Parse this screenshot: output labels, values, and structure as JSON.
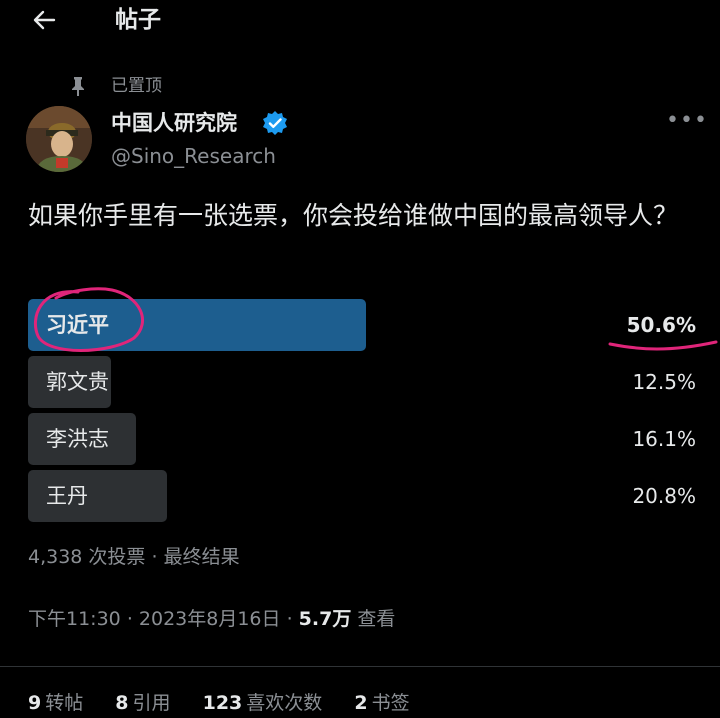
{
  "header": {
    "title": "帖子"
  },
  "pinned": {
    "label": "已置顶"
  },
  "author": {
    "name": "中国人研究院",
    "handle": "@Sino_Research"
  },
  "tweet": {
    "text": "如果你手里有一张选票，你会投给谁做中国的最高领导人？"
  },
  "poll": {
    "options": [
      {
        "label": "习近平",
        "percent": "50.6%",
        "fraction": 0.506,
        "winner": true
      },
      {
        "label": "郭文贵",
        "percent": "12.5%",
        "fraction": 0.125,
        "winner": false
      },
      {
        "label": "李洪志",
        "percent": "16.1%",
        "fraction": 0.161,
        "winner": false
      },
      {
        "label": "王丹",
        "percent": "20.8%",
        "fraction": 0.208,
        "winner": false
      }
    ],
    "votes": "4,338 次投票",
    "separator": "·",
    "status": "最终结果"
  },
  "post_meta": {
    "time": "下午11:30",
    "separator": "·",
    "date": "2023年8月16日",
    "views_count": "5.7万",
    "views_label": "查看"
  },
  "stats": {
    "retweets_count": "9",
    "retweets_label": "转帖",
    "quotes_count": "8",
    "quotes_label": "引用",
    "likes_count": "123",
    "likes_label": "喜欢次数",
    "bookmarks_count": "2",
    "bookmarks_label": "书签"
  },
  "colors": {
    "background": "#000000",
    "text": "#e7e9ea",
    "muted": "#8b8f94",
    "winner_bar": "#1d5e8f",
    "bar": "#2d3033",
    "verified": "#1d9bf0",
    "annotation": "#e0257a"
  },
  "icons": [
    "back-arrow-icon",
    "pin-icon",
    "verified-badge-icon",
    "more-icon"
  ]
}
